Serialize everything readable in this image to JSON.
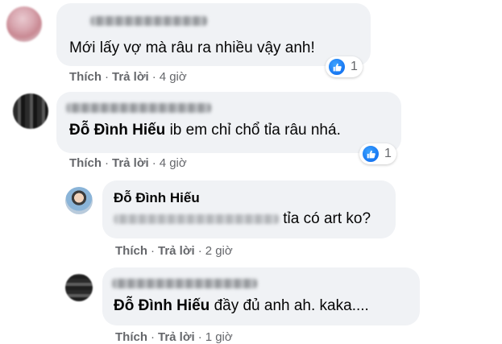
{
  "comments": [
    {
      "text": "Mới lấy vợ mà râu ra nhiều vậy anh!",
      "actions": {
        "like": "Thích",
        "reply": "Trả lời",
        "time": "4 giờ"
      },
      "reaction_count": "1"
    },
    {
      "mention": "Đỗ Đình Hiếu",
      "text": "ib em chỉ chổ tỉa râu nhá.",
      "actions": {
        "like": "Thích",
        "reply": "Trả lời",
        "time": "4 giờ"
      },
      "reaction_count": "1"
    },
    {
      "author": "Đỗ Đình Hiếu",
      "text": "tỉa có art ko?",
      "actions": {
        "like": "Thích",
        "reply": "Trả lời",
        "time": "2 giờ"
      }
    },
    {
      "mention": "Đỗ Đình Hiếu",
      "text": "đầy đủ anh ah. kaka....",
      "actions": {
        "like": "Thích",
        "reply": "Trả lời",
        "time": "1 giờ"
      }
    }
  ],
  "separator": "·",
  "icons": {
    "reaction": "like-icon"
  },
  "colors": {
    "bubble": "#f0f2f5",
    "secondary_text": "#65676b",
    "like_blue": "#1877f2"
  }
}
